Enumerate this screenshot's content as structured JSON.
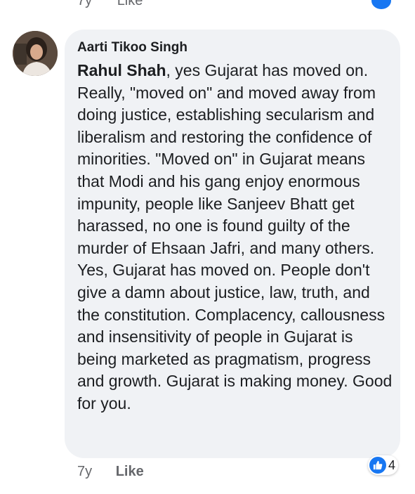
{
  "previous_comment": {
    "time": "7y",
    "like_label": "Like"
  },
  "comment": {
    "author": "Aarti Tikoo Singh",
    "mention": "Rahul Shah",
    "text": ", yes Gujarat has moved on. Really, \"moved on\" and moved away from doing justice, establishing secularism and liberalism and restoring the confidence of minorities. \"Moved on\" in Gujarat means that Modi and his gang enjoy enormous impunity, people like Sanjeev Bhatt get harassed, no one is found guilty of the murder of Ehsaan Jafri, and many others. Yes, Gujarat has moved on. People don't give a damn about justice, law, truth, and the constitution. Complacency, callousness and insensitivity of people in Gujarat is being marketed as pragmatism, progress and growth. Gujarat is making money. Good for you.",
    "time": "7y",
    "like_label": "Like",
    "reaction_icon": "thumbs-up-icon",
    "reaction_count": "4"
  },
  "colors": {
    "bubble": "#f0f2f5",
    "meta_text": "#65676b",
    "like_blue": "#1877f2"
  }
}
